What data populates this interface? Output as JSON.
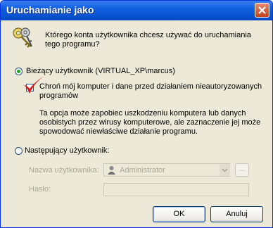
{
  "window": {
    "title": "Uruchamianie jako"
  },
  "question": "Którego konta użytkownika chcesz używać do uruchamiania tego programu?",
  "current_user": {
    "label": "Bieżący użytkownik (VIRTUAL_XP\\marcus)",
    "selected": true
  },
  "protect": {
    "label": "Chroń mój komputer i dane przed działaniem nieautoryzowanych programów",
    "checked": true,
    "warning": "Ta opcja może zapobiec uszkodzeniu komputera lub danych osobistych przez wirusy komputerowe, ale zaznaczenie jej może spowodować niewłaściwe działanie programu."
  },
  "other_user": {
    "label": "Następujący użytkownik:",
    "selected": false,
    "username_label": "Nazwa użytkownika:",
    "username_value": "Administrator",
    "browse_label": "...",
    "password_label": "Hasło:"
  },
  "buttons": {
    "ok": "OK",
    "cancel": "Anuluj"
  },
  "colors": {
    "titlebar": "#0a56d4",
    "face": "#ece9d8",
    "radio_dot": "#21a121",
    "checkmark": "#d81a1a",
    "disabled_text": "#aca899"
  },
  "icons": {
    "dialog": "keys-icon",
    "close": "close-icon",
    "user": "user-icon",
    "dropdown": "chevron-down-icon"
  }
}
